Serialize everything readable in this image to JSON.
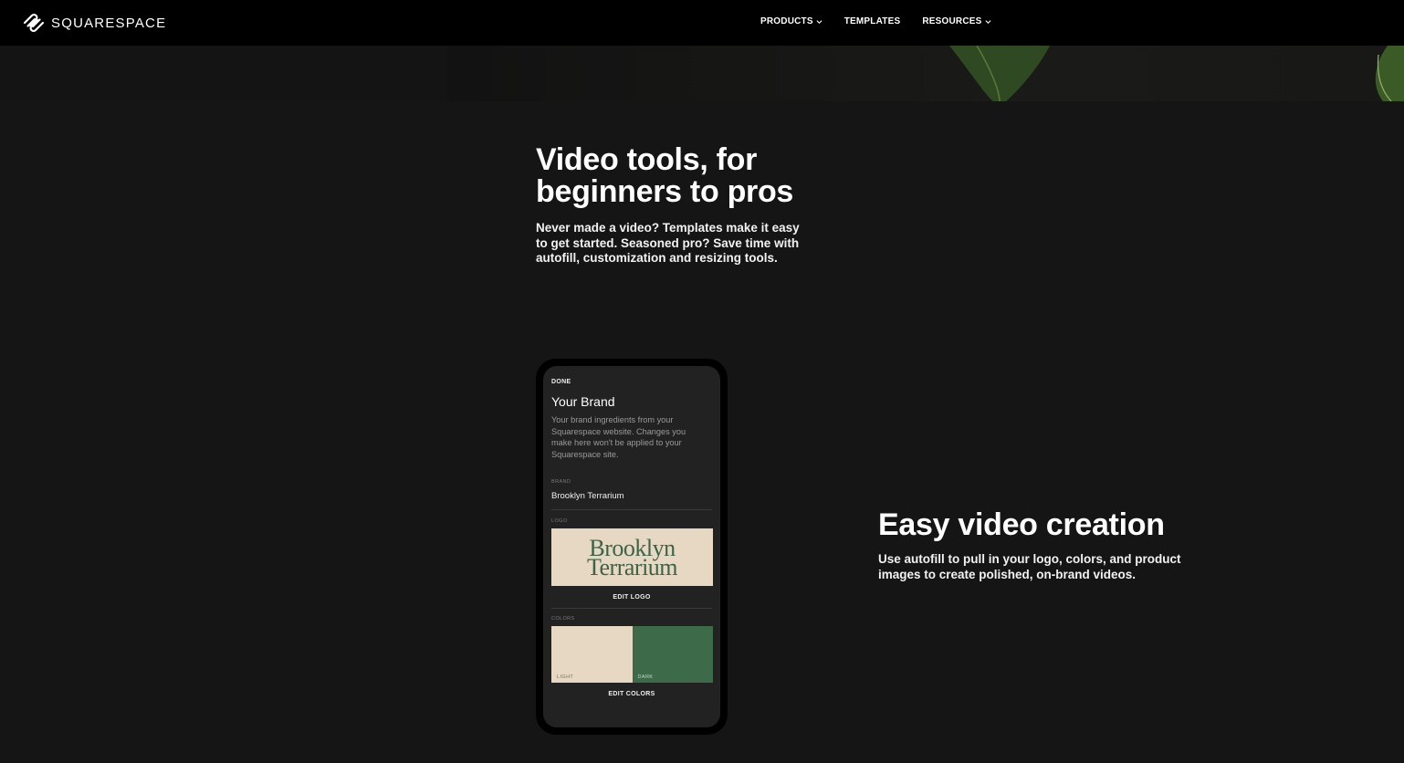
{
  "header": {
    "brand": "SQUARESPACE",
    "logo_icon": "squarespace-logo-icon",
    "nav": [
      {
        "label": "PRODUCTS",
        "has_dropdown": true
      },
      {
        "label": "TEMPLATES",
        "has_dropdown": false
      },
      {
        "label": "RESOURCES",
        "has_dropdown": true
      }
    ]
  },
  "intro": {
    "title": "Video tools, for beginners to pros",
    "description": "Never made a video? Templates make it easy to get started. Seasoned pro? Save time with autofill, customization and resizing tools."
  },
  "phone": {
    "done_label": "DONE",
    "title": "Your Brand",
    "description": "Your brand ingredients from your Squarespace website. Changes you make here won't be applied to your Squarespace site.",
    "brand_label": "BRAND",
    "brand_value": "Brooklyn Terrarium",
    "logo_label": "LOGO",
    "logo_line1": "Brooklyn",
    "logo_line2": "Terrarium",
    "edit_logo": "EDIT LOGO",
    "colors_label": "COLORS",
    "light_label": "LIGHT",
    "dark_label": "DARK",
    "light_color": "#e6d8c2",
    "dark_color": "#3d6a48",
    "edit_colors": "EDIT COLORS"
  },
  "feature": {
    "title": "Easy video creation",
    "description": "Use autofill to pull in your logo, colors, and product images to create polished, on-brand videos."
  },
  "colors": {
    "background": "#151515",
    "topbar": "#000000",
    "accent_green": "#3d6347"
  }
}
